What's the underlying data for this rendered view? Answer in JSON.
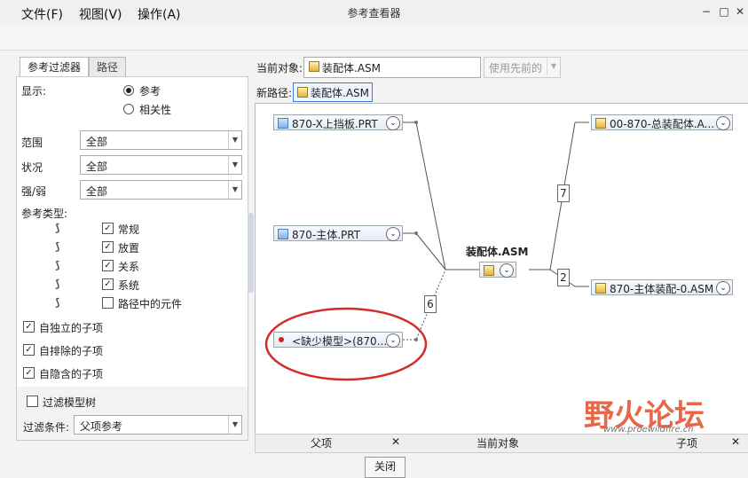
{
  "window": {
    "title": "参考查看器",
    "min": "−",
    "max": "□",
    "close": "✕"
  },
  "menu": {
    "file": "文件(F)",
    "view": "视图(V)",
    "ops": "操作(A)"
  },
  "tabs": {
    "filter": "参考过滤器",
    "path": "路径"
  },
  "display": {
    "label": "显示:",
    "opt1": "参考",
    "opt2": "相关性",
    "selected": "参考"
  },
  "scope": {
    "label": "范围",
    "value": "全部"
  },
  "status": {
    "label": "状况",
    "value": "全部"
  },
  "strength": {
    "label": "强/弱",
    "value": "全部"
  },
  "reftypes": {
    "label": "参考类型:",
    "items": [
      {
        "label": "常规",
        "checked": true
      },
      {
        "label": "放置",
        "checked": true
      },
      {
        "label": "关系",
        "checked": true
      },
      {
        "label": "系统",
        "checked": true
      },
      {
        "label": "路径中的元件",
        "checked": false
      }
    ]
  },
  "children": {
    "items": [
      {
        "label": "自独立的子项",
        "checked": true
      },
      {
        "label": "自排除的子项",
        "checked": true
      },
      {
        "label": "自隐含的子项",
        "checked": true
      }
    ]
  },
  "filter_tree": {
    "label": "过滤模型树",
    "checked": false
  },
  "filter_cond": {
    "label": "过滤条件:",
    "value": "父项参考"
  },
  "current": {
    "label": "当前对象:",
    "value": "装配体.ASM",
    "use_prev": "使用先前的"
  },
  "newpath": {
    "label": "新路径:",
    "value": "装配体.ASM"
  },
  "graph": {
    "center": {
      "title": "装配体.ASM"
    },
    "parents": [
      {
        "label": "870-X上挡板.PRT"
      },
      {
        "label": "870-主体.PRT"
      },
      {
        "label": "<缺少模型>(870..."
      }
    ],
    "children": [
      {
        "label": "00-870-总装配体.A..."
      },
      {
        "label": "870-主体装配-0.ASM"
      }
    ],
    "counts": {
      "top": "7",
      "bottom": "2",
      "missing": "6"
    }
  },
  "bottom": {
    "parents": "父项",
    "current": "当前对象",
    "children": "子项",
    "close_x": "✕"
  },
  "close_button": "关闭",
  "watermark": {
    "text": "野火论坛",
    "url": "www.proewildfire.cn"
  }
}
